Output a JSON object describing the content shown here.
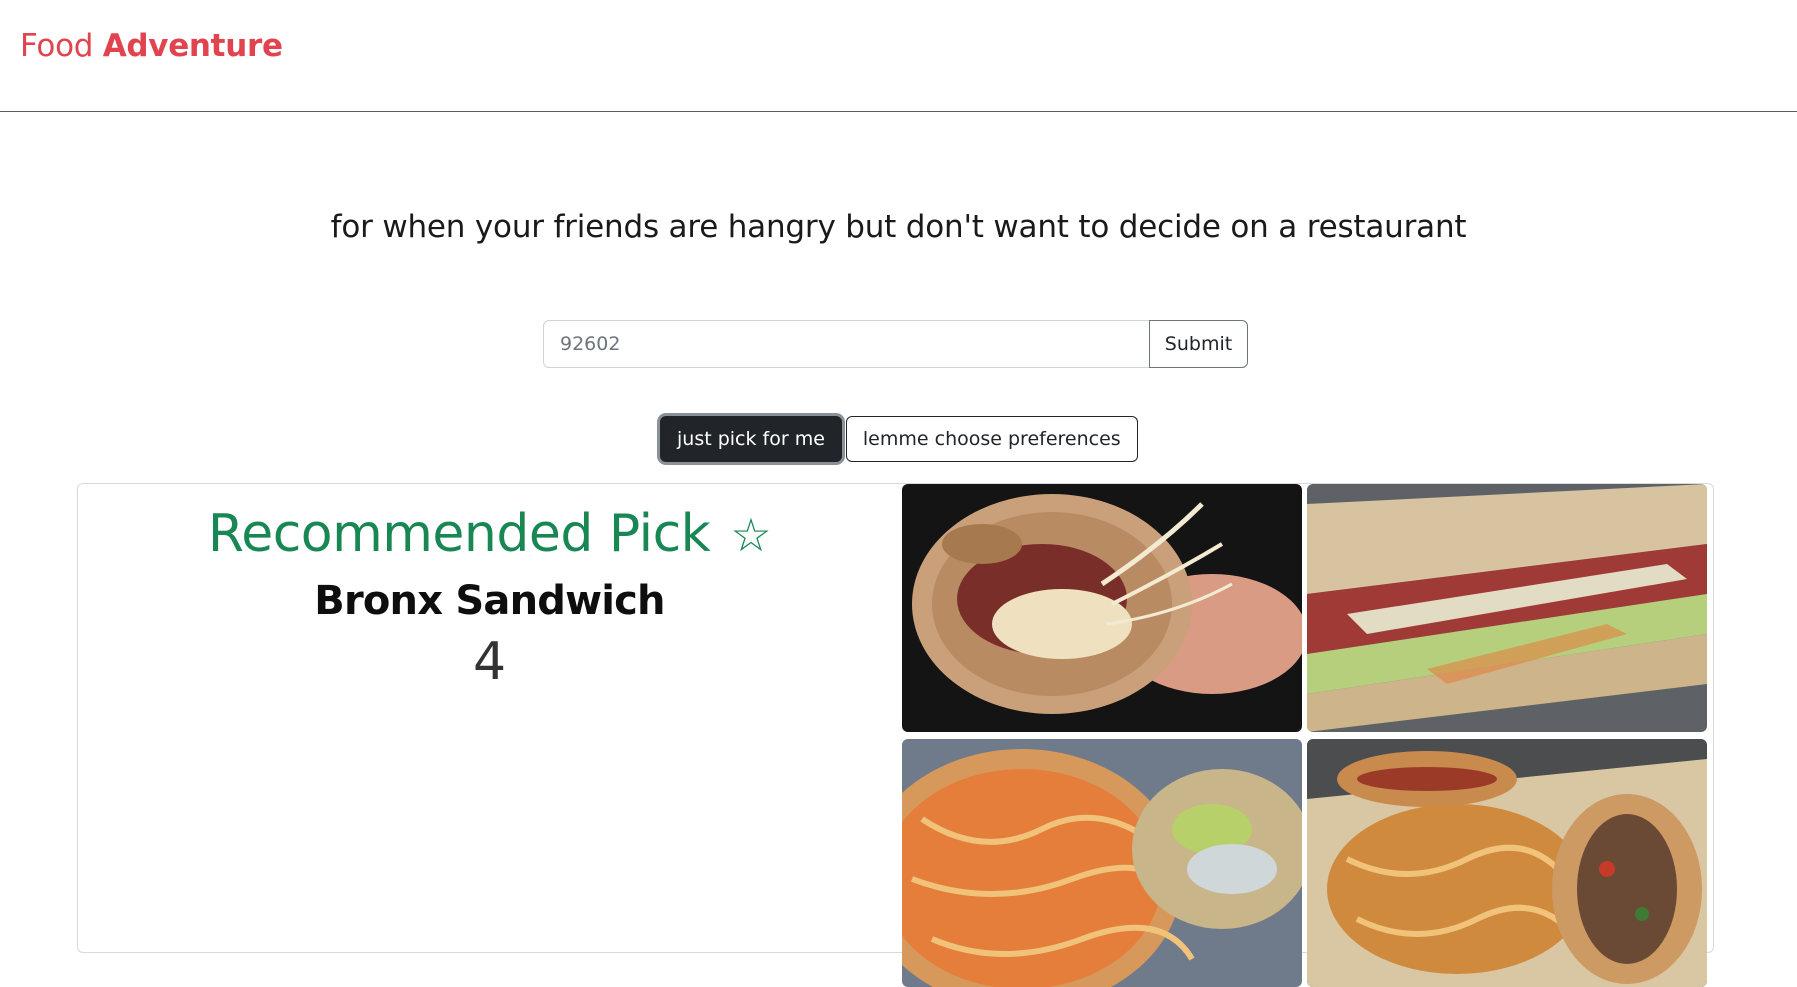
{
  "navbar": {
    "brand_part1": "Food",
    "brand_part2": "Adventure"
  },
  "tagline": "for when your friends are hangry but don't want to decide on a restaurant",
  "search": {
    "placeholder": "92602",
    "value": "",
    "submit_label": "Submit"
  },
  "mode_buttons": {
    "pick_label": "just pick for me",
    "prefs_label": "lemme choose preferences",
    "active": "pick"
  },
  "recommendation": {
    "heading": "Recommended Pick",
    "star_icon": "☆",
    "restaurant_name": "Bronx Sandwich",
    "rating": "4"
  },
  "photos": [
    {
      "icon": "sandwich-photo",
      "subject": "melted cheese pastrami sandwich"
    },
    {
      "icon": "sandwich-photo",
      "subject": "pastrami coleslaw sandwich"
    },
    {
      "icon": "sandwich-photo",
      "subject": "loaded fries sandwich"
    },
    {
      "icon": "sandwich-photo",
      "subject": "hot dogs with fries"
    }
  ],
  "colors": {
    "brand": "#e0444e",
    "accent_green": "#198754",
    "active_button": "#212529"
  }
}
